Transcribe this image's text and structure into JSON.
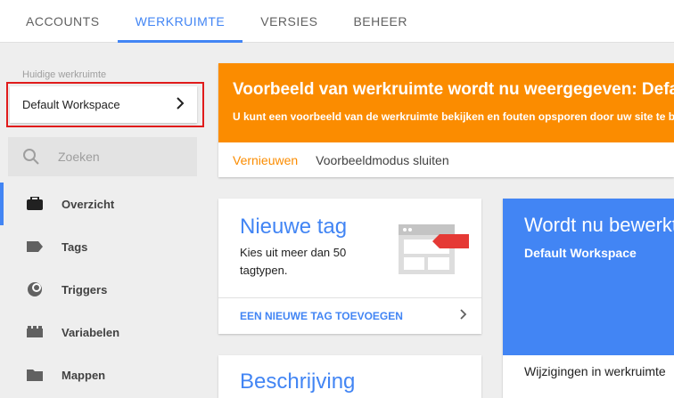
{
  "nav": {
    "tabs": [
      {
        "label": "ACCOUNTS",
        "active": false
      },
      {
        "label": "WERKRUIMTE",
        "active": true
      },
      {
        "label": "VERSIES",
        "active": false
      },
      {
        "label": "BEHEER",
        "active": false
      }
    ]
  },
  "sidebar": {
    "workspace_label": "Huidige werkruimte",
    "workspace_name": "Default Workspace",
    "search_placeholder": "Zoeken",
    "items": [
      {
        "label": "Overzicht",
        "icon": "briefcase-icon",
        "active": true
      },
      {
        "label": "Tags",
        "icon": "tag-icon",
        "active": false
      },
      {
        "label": "Triggers",
        "icon": "trigger-icon",
        "active": false
      },
      {
        "label": "Variabelen",
        "icon": "variable-icon",
        "active": false
      },
      {
        "label": "Mappen",
        "icon": "folder-icon",
        "active": false
      }
    ]
  },
  "banner": {
    "title": "Voorbeeld van werkruimte wordt nu weergegeven: Default Workspace",
    "subtitle": "U kunt een voorbeeld van de werkruimte bekijken en fouten opsporen door uw site te bekijken",
    "renew_label": "Vernieuwen",
    "close_label": "Voorbeeldmodus sluiten"
  },
  "new_tag_card": {
    "title": "Nieuwe tag",
    "description": "Kies uit meer dan 50 tagtypen.",
    "action_label": "EEN NIEUWE TAG TOEVOEGEN"
  },
  "editing_card": {
    "title": "Wordt nu bewerkt",
    "workspace": "Default Workspace",
    "changes_label": "Wijzigingen in werkruimte"
  },
  "description_card": {
    "title": "Beschrijving"
  },
  "colors": {
    "accent": "#4285f4",
    "banner": "#fb8c00",
    "highlight": "#e01b1b"
  }
}
